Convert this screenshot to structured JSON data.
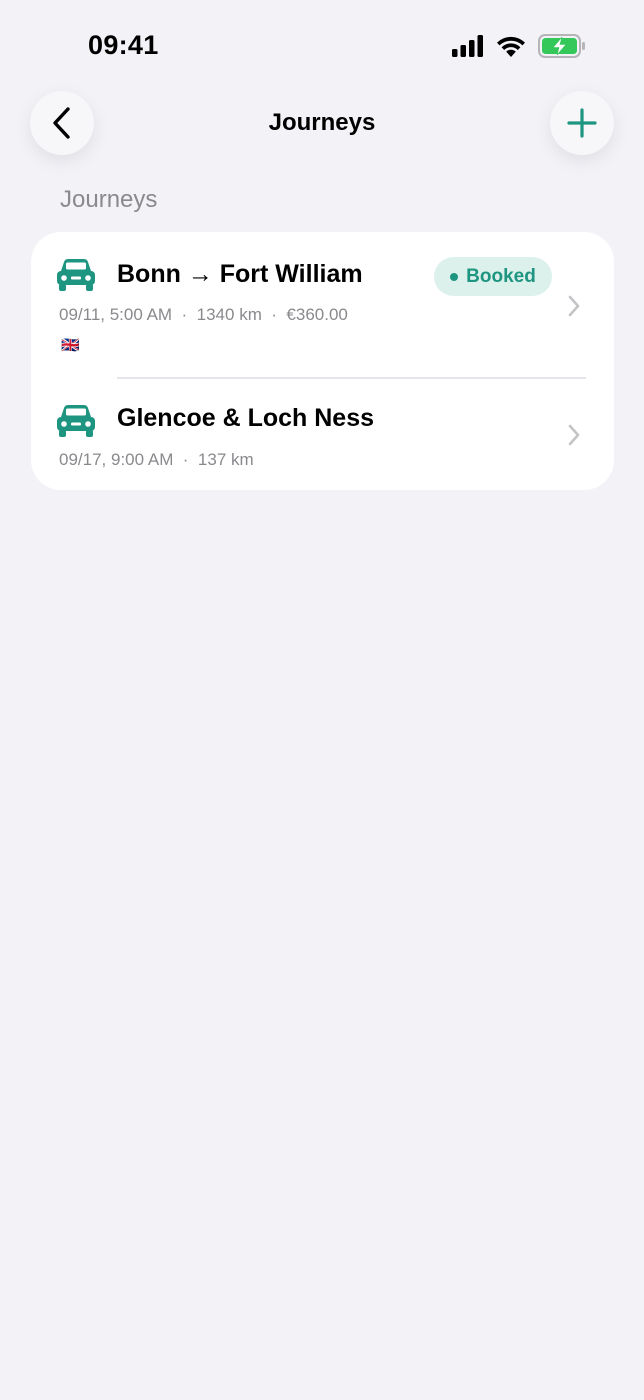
{
  "status_bar": {
    "time": "09:41",
    "icons": [
      "cellular-signal-icon",
      "wifi-icon",
      "battery-charging-icon"
    ]
  },
  "header": {
    "title": "Journeys",
    "back_icon": "chevron-left-icon",
    "add_icon": "plus-icon"
  },
  "section": {
    "label": "Journeys"
  },
  "journeys": [
    {
      "icon": "car-icon",
      "title": "Bonn → Fort William",
      "meta": "09/11, 5:00 AM  ·  1340 km  ·  €360.00",
      "flag": "🇬🇧",
      "badge": "Booked"
    },
    {
      "icon": "car-icon",
      "title": "Glencoe & Loch Ness",
      "meta": "09/17, 9:00 AM  ·  137 km"
    }
  ],
  "colors": {
    "background": "#F2F2F7",
    "accent": "#1E9580",
    "badge_bg": "#DDF1EC",
    "secondary_text": "#8A8A8E",
    "battery": "#34C759"
  }
}
